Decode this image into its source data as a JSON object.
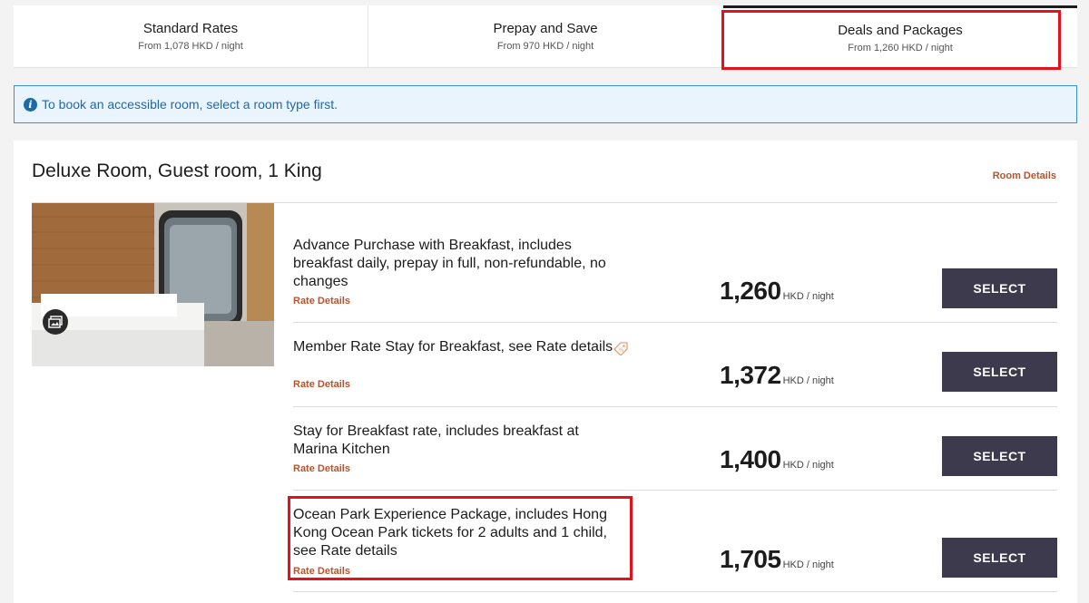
{
  "tabs": [
    {
      "title": "Standard Rates",
      "sub": "From 1,078 HKD / night"
    },
    {
      "title": "Prepay and Save",
      "sub": "From 970 HKD / night"
    },
    {
      "title": "Deals and Packages",
      "sub": "From 1,260 HKD / night"
    }
  ],
  "active_tab": "Deals and Packages",
  "info_banner": {
    "icon": "info-icon",
    "text": "To book an accessible room, select a room type first."
  },
  "room": {
    "title": "Deluxe Room, Guest room, 1 King",
    "details_link": "Room Details",
    "photo_icon": "gallery-icon"
  },
  "rates": [
    {
      "name": "Advance Purchase with Breakfast, includes breakfast daily, prepay in full, non-refundable, no changes",
      "link": "Rate Details",
      "price": "1,260",
      "unit": "HKD / night",
      "button": "SELECT"
    },
    {
      "name": "Member Rate Stay for Breakfast, see Rate details",
      "link": "Rate Details",
      "price": "1,372",
      "unit": "HKD / night",
      "button": "SELECT",
      "icon": "tag-icon"
    },
    {
      "name": "Stay for Breakfast rate, includes breakfast at Marina Kitchen",
      "link": "Rate Details",
      "price": "1,400",
      "unit": "HKD / night",
      "button": "SELECT"
    },
    {
      "name": "Ocean Park Experience Package, includes Hong Kong Ocean Park tickets for 2 adults and 1 child, see Rate details",
      "link": "Rate Details",
      "price": "1,705",
      "unit": "HKD / night",
      "button": "SELECT"
    }
  ],
  "colors": {
    "accent_link": "#b4542d",
    "button_bg": "#3c3a4c",
    "highlight": "#e8101b",
    "info_border": "#3e8fd1"
  }
}
